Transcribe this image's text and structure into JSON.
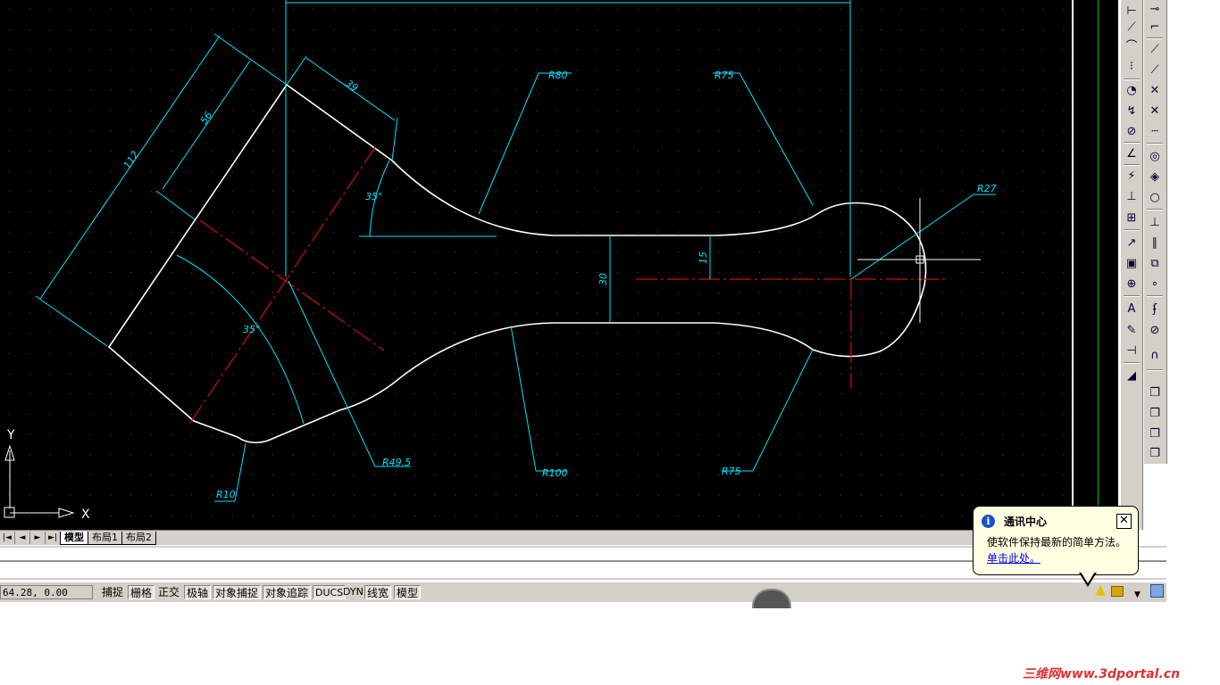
{
  "drawing": {
    "dimensions": [
      "112",
      "56",
      "39",
      "35°",
      "35°",
      "30",
      "15",
      "R80",
      "R75",
      "R27",
      "R49.5",
      "R10",
      "R100",
      "R75"
    ],
    "ucs_x_label": "X",
    "ucs_y_label": "Y",
    "colors": {
      "background": "#000000",
      "dimension": "#00ffff",
      "centerline": "#ff0000",
      "geometry": "#ffffff",
      "grid": "#4a4a4a"
    }
  },
  "layout_tabs": {
    "nav_buttons": [
      "|◄",
      "◄",
      "►",
      "►|"
    ],
    "tabs": [
      "模型",
      "布局1",
      "布局2"
    ]
  },
  "status_bar": {
    "coords": "64.28, 0.00",
    "buttons": [
      "捕捉",
      "栅格",
      "正交",
      "极轴",
      "对象捕捉",
      "对象追踪",
      "DUCS",
      "DYN",
      "线宽",
      "模型"
    ]
  },
  "notification": {
    "title": "通讯中心",
    "message": "使软件保持最新的简单方法。",
    "link": "单击此处。",
    "close_label": "✕"
  },
  "watermark": "三维网www.3dportal.cn",
  "toolbar_dimension": {
    "icons": [
      "linear-dim-icon",
      "aligned-dim-icon",
      "arc-length-icon",
      "ordinate-icon",
      "radius-icon",
      "jogged-icon",
      "diameter-icon",
      "angular-icon",
      "quick-dim-icon",
      "baseline-icon",
      "continue-icon",
      "qleader-icon",
      "tolerance-icon",
      "center-mark-icon",
      "dimedit-icon",
      "dimtedit-icon",
      "dimupdate-icon",
      "dimstyle-icon"
    ]
  },
  "toolbar_osnap": {
    "icons": [
      "snap-from-icon",
      "endpoint-icon",
      "midpoint-icon",
      "intersection-icon",
      "apparent-intersection-icon",
      "extension-icon",
      "center-icon",
      "quadrant-icon",
      "tangent-icon",
      "perpendicular-icon",
      "parallel-icon",
      "insert-icon",
      "node-icon",
      "nearest-icon",
      "none-icon",
      "osnap-settings-icon",
      "layer-icon-1",
      "layer-icon-2",
      "layer-icon-3",
      "layer-icon-4"
    ]
  }
}
